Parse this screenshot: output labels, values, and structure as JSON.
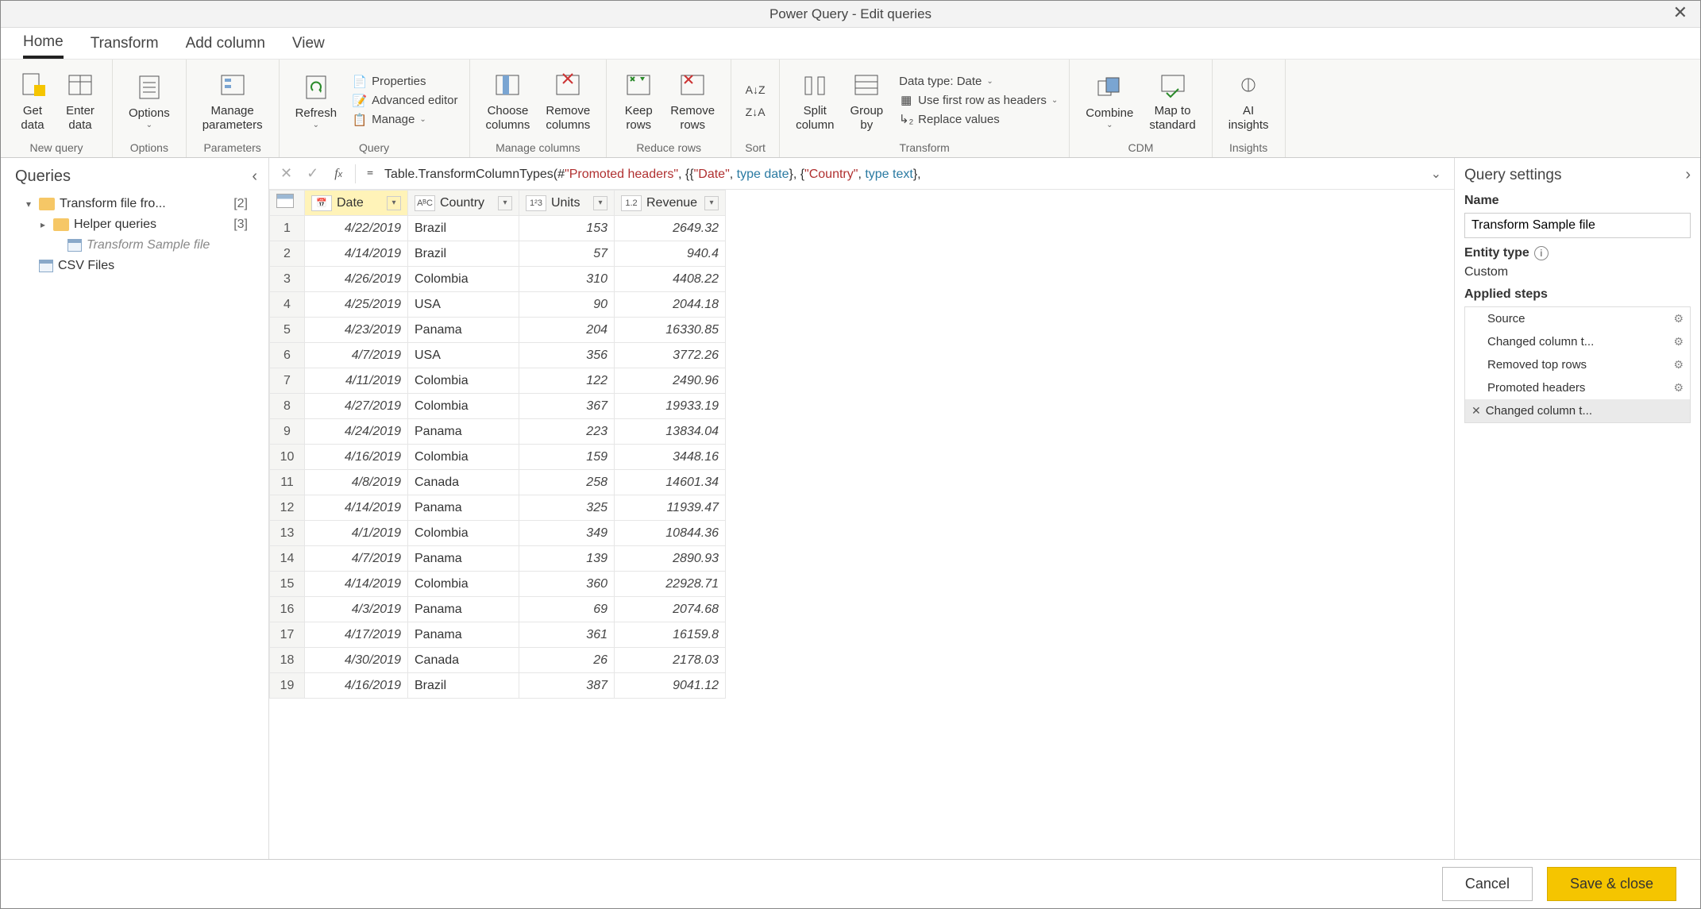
{
  "window": {
    "title": "Power Query - Edit queries"
  },
  "menu": {
    "tabs": [
      "Home",
      "Transform",
      "Add column",
      "View"
    ],
    "active": 0
  },
  "ribbon": {
    "new_query": {
      "get_data": "Get\ndata",
      "enter_data": "Enter\ndata",
      "label": "New query"
    },
    "options": {
      "options": "Options",
      "label": "Options"
    },
    "parameters": {
      "manage_params": "Manage\nparameters",
      "label": "Parameters"
    },
    "query": {
      "refresh": "Refresh",
      "properties": "Properties",
      "advanced": "Advanced editor",
      "manage": "Manage",
      "label": "Query"
    },
    "manage_cols": {
      "choose": "Choose\ncolumns",
      "remove": "Remove\ncolumns",
      "label": "Manage columns"
    },
    "reduce": {
      "keep": "Keep\nrows",
      "remove": "Remove\nrows",
      "label": "Reduce rows"
    },
    "sort": {
      "label": "Sort"
    },
    "transform": {
      "split": "Split\ncolumn",
      "group": "Group\nby",
      "dtype": "Data type: Date",
      "firstrow": "Use first row as headers",
      "replace": "Replace values",
      "label": "Transform"
    },
    "cdm": {
      "combine": "Combine",
      "map": "Map to\nstandard",
      "label": "CDM"
    },
    "insights": {
      "ai": "AI\ninsights",
      "label": "Insights"
    }
  },
  "queries_panel": {
    "title": "Queries",
    "tree": [
      {
        "label": "Transform file fro...",
        "count": "[2]",
        "type": "folder",
        "level": 0,
        "arrow": "▾"
      },
      {
        "label": "Helper queries",
        "count": "[3]",
        "type": "folder",
        "level": 1,
        "arrow": "▸"
      },
      {
        "label": "Transform Sample file",
        "type": "table",
        "level": 2,
        "muted": true
      },
      {
        "label": "CSV Files",
        "type": "table",
        "level": 0
      }
    ]
  },
  "formula_bar": {
    "prefix": "Table.TransformColumnTypes(#",
    "s1": "\"Promoted headers\"",
    "mid": ", {{",
    "s2": "\"Date\"",
    "mid2": ", ",
    "kw1": "type date",
    "mid3": "}, {",
    "s3": "\"Country\"",
    "mid4": ", ",
    "kw2": "type text",
    "tail": "},"
  },
  "grid": {
    "columns": [
      {
        "name": "Date",
        "typ": "📅",
        "sel": true
      },
      {
        "name": "Country",
        "typ": "AᴮC"
      },
      {
        "name": "Units",
        "typ": "1²3"
      },
      {
        "name": "Revenue",
        "typ": "1.2"
      }
    ],
    "rows": [
      {
        "n": 1,
        "date": "4/22/2019",
        "country": "Brazil",
        "units": "153",
        "rev": "2649.32"
      },
      {
        "n": 2,
        "date": "4/14/2019",
        "country": "Brazil",
        "units": "57",
        "rev": "940.4"
      },
      {
        "n": 3,
        "date": "4/26/2019",
        "country": "Colombia",
        "units": "310",
        "rev": "4408.22"
      },
      {
        "n": 4,
        "date": "4/25/2019",
        "country": "USA",
        "units": "90",
        "rev": "2044.18"
      },
      {
        "n": 5,
        "date": "4/23/2019",
        "country": "Panama",
        "units": "204",
        "rev": "16330.85"
      },
      {
        "n": 6,
        "date": "4/7/2019",
        "country": "USA",
        "units": "356",
        "rev": "3772.26"
      },
      {
        "n": 7,
        "date": "4/11/2019",
        "country": "Colombia",
        "units": "122",
        "rev": "2490.96"
      },
      {
        "n": 8,
        "date": "4/27/2019",
        "country": "Colombia",
        "units": "367",
        "rev": "19933.19"
      },
      {
        "n": 9,
        "date": "4/24/2019",
        "country": "Panama",
        "units": "223",
        "rev": "13834.04"
      },
      {
        "n": 10,
        "date": "4/16/2019",
        "country": "Colombia",
        "units": "159",
        "rev": "3448.16"
      },
      {
        "n": 11,
        "date": "4/8/2019",
        "country": "Canada",
        "units": "258",
        "rev": "14601.34"
      },
      {
        "n": 12,
        "date": "4/14/2019",
        "country": "Panama",
        "units": "325",
        "rev": "11939.47"
      },
      {
        "n": 13,
        "date": "4/1/2019",
        "country": "Colombia",
        "units": "349",
        "rev": "10844.36"
      },
      {
        "n": 14,
        "date": "4/7/2019",
        "country": "Panama",
        "units": "139",
        "rev": "2890.93"
      },
      {
        "n": 15,
        "date": "4/14/2019",
        "country": "Colombia",
        "units": "360",
        "rev": "22928.71"
      },
      {
        "n": 16,
        "date": "4/3/2019",
        "country": "Panama",
        "units": "69",
        "rev": "2074.68"
      },
      {
        "n": 17,
        "date": "4/17/2019",
        "country": "Panama",
        "units": "361",
        "rev": "16159.8"
      },
      {
        "n": 18,
        "date": "4/30/2019",
        "country": "Canada",
        "units": "26",
        "rev": "2178.03"
      },
      {
        "n": 19,
        "date": "4/16/2019",
        "country": "Brazil",
        "units": "387",
        "rev": "9041.12"
      }
    ]
  },
  "settings": {
    "title": "Query settings",
    "name_label": "Name",
    "name_value": "Transform Sample file",
    "entity_label": "Entity type",
    "entity_value": "Custom",
    "steps_label": "Applied steps",
    "steps": [
      {
        "label": "Source",
        "gear": true
      },
      {
        "label": "Changed column t...",
        "gear": true
      },
      {
        "label": "Removed top rows",
        "gear": true
      },
      {
        "label": "Promoted headers",
        "gear": true
      },
      {
        "label": "Changed column t...",
        "active": true
      }
    ]
  },
  "footer": {
    "cancel": "Cancel",
    "save": "Save & close"
  }
}
